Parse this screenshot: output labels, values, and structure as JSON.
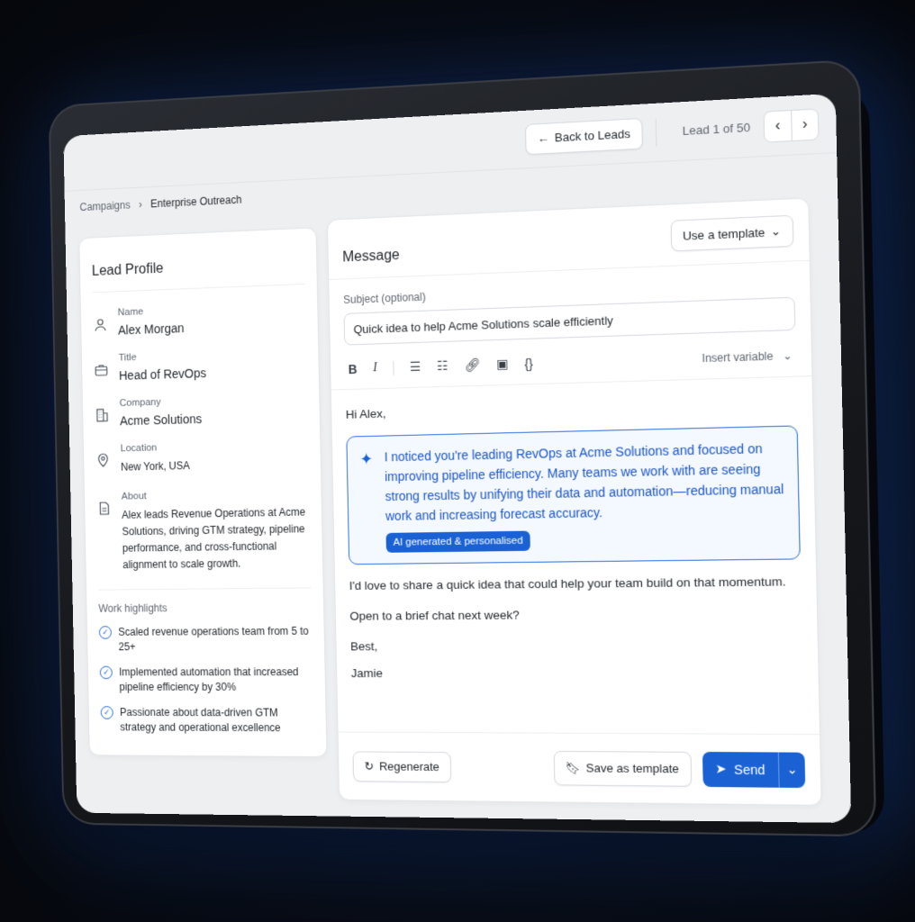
{
  "topbar": {
    "back_label": "Back to Leads",
    "lead_counter": "Lead 1 of 50",
    "prev_icon": "chevron-left-icon",
    "next_icon": "chevron-right-icon"
  },
  "breadcrumb": {
    "root": "Campaigns",
    "current": "Enterprise Outreach"
  },
  "profile": {
    "title": "Lead Profile",
    "name_label": "Name",
    "name": "Alex Morgan",
    "title_label": "Title",
    "title_value": "Head of RevOps",
    "company_label": "Company",
    "company": "Acme Solutions",
    "location_label": "Location",
    "location": "New York, USA",
    "about_label": "About",
    "about": "Alex leads Revenue Operations at Acme Solutions, driving GTM strategy, pipeline performance, and cross-functional alignment to scale growth.",
    "highlights_title": "Work highlights",
    "highlights": [
      "Scaled revenue operations team from 5 to 25+",
      "Implemented automation that increased pipeline efficiency by 30%",
      "Passionate about data-driven GTM strategy and operational excellence"
    ]
  },
  "message": {
    "title": "Message",
    "template_label": "Use a template",
    "subject_label": "Subject (optional)",
    "subject_value": "Quick idea to help Acme Solutions scale efficiently",
    "insert_variable": "Insert variable",
    "greeting": "Hi Alex,",
    "ai_text": "I noticed you're leading RevOps at Acme Solutions and focused on improving pipeline efficiency. Many teams we work with are seeing strong results by unifying their data and automation—reducing manual work and increasing forecast accuracy.",
    "ai_badge": "AI generated & personalised",
    "para2": "I'd love to share a quick idea that could help your team build on that momentum.",
    "para3": "Open to a brief chat next week?",
    "signoff": "Best,",
    "signature": "Jamie"
  },
  "footer": {
    "regenerate_label": "Regenerate",
    "save_template_label": "Save as template",
    "send_label": "Send"
  },
  "colors": {
    "accent": "#1a62d4",
    "ai_bg": "#f4f8ff"
  }
}
